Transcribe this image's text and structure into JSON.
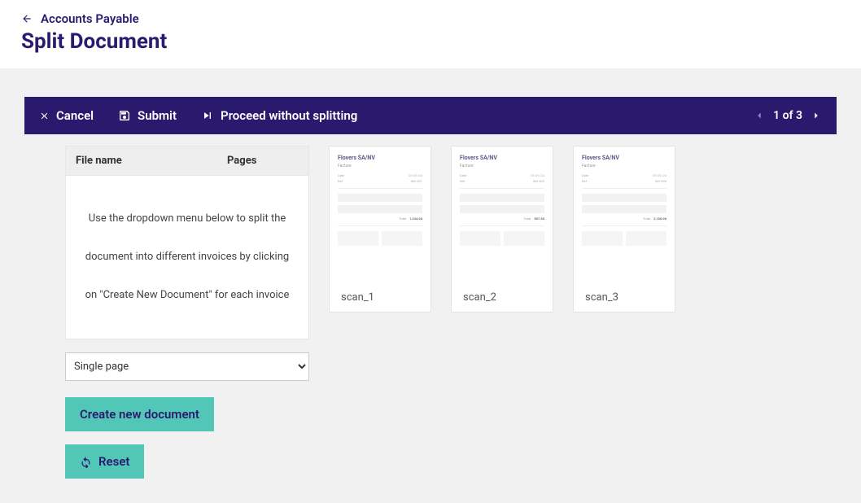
{
  "header": {
    "breadcrumb": "Accounts Payable",
    "title": "Split Document"
  },
  "actionBar": {
    "cancel": "Cancel",
    "submit": "Submit",
    "proceed": "Proceed without splitting",
    "pager": "1 of 3"
  },
  "table": {
    "colFile": "File name",
    "colPages": "Pages",
    "instructions": "Use the dropdown menu below to split the document into different invoices by clicking on \"Create New Document\" for each invoice"
  },
  "form": {
    "selectValue": "Single page",
    "createBtn": "Create new document",
    "resetBtn": "Reset"
  },
  "thumbs": [
    {
      "label": "scan_1",
      "docTitle": "Flovers SA/NV"
    },
    {
      "label": "scan_2",
      "docTitle": "Flovers SA/NV"
    },
    {
      "label": "scan_3",
      "docTitle": "Flovers SA/NV"
    }
  ],
  "colors": {
    "primaryDark": "#2b1a6d",
    "accent": "#52c7b8"
  }
}
